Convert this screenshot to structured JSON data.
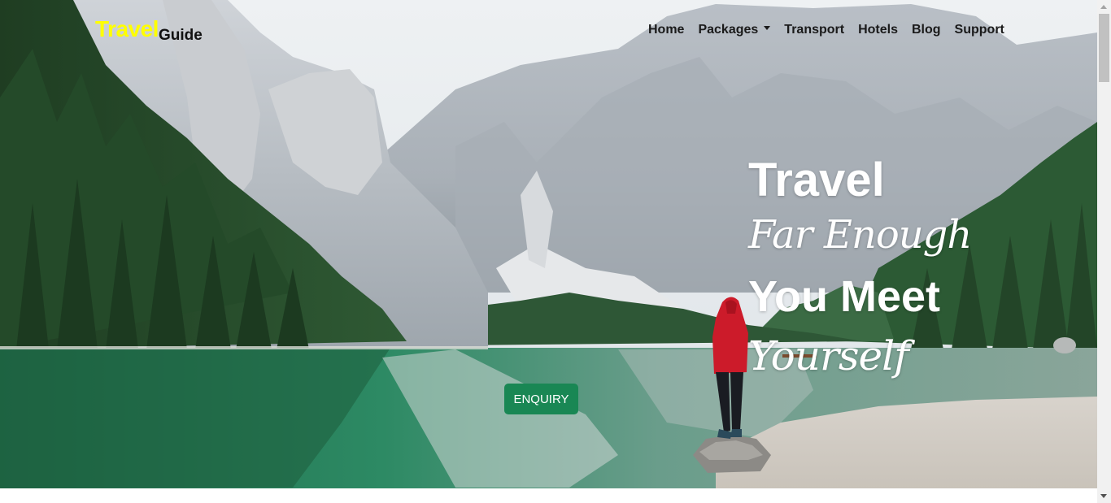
{
  "brand": {
    "part1": "Travel",
    "part2": "Guide",
    "part1_color": "#ffff00",
    "part2_color": "#111111"
  },
  "nav": {
    "items": [
      {
        "label": "Home"
      },
      {
        "label": "Packages",
        "has_dropdown": true
      },
      {
        "label": "Transport"
      },
      {
        "label": "Hotels"
      },
      {
        "label": "Blog"
      },
      {
        "label": "Support"
      }
    ]
  },
  "hero": {
    "line1": "Travel",
    "line2": "Far Enough",
    "line3": "You Meet",
    "line4": "Yourself",
    "button_label": "ENQUIRY",
    "button_color": "#198754"
  },
  "icons": {
    "dropdown": "chevron-down-icon",
    "scroll_up": "scroll-up-arrow-icon",
    "scroll_down": "scroll-down-arrow-icon"
  }
}
